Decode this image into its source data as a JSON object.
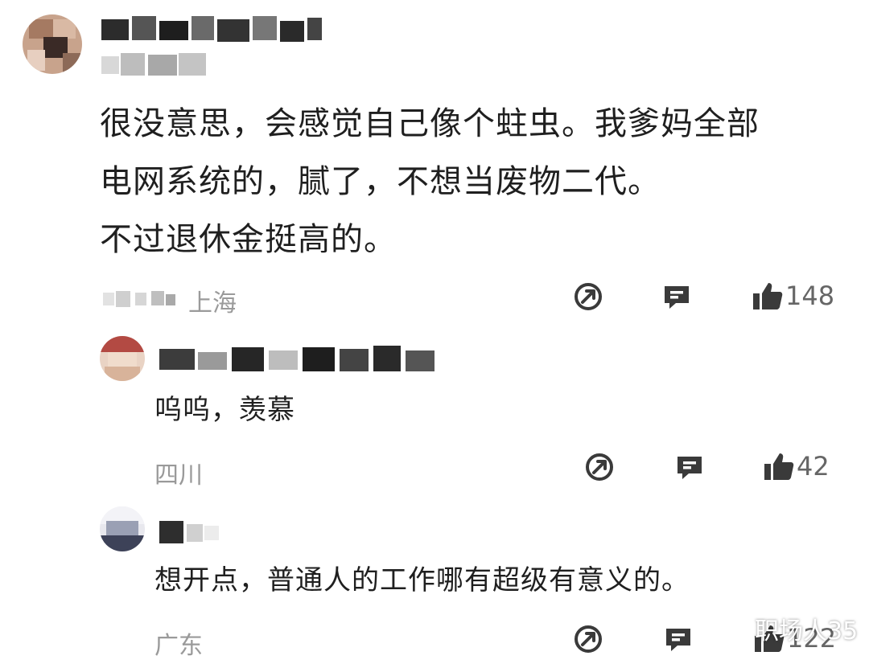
{
  "comments": [
    {
      "id": "main",
      "text_lines": [
        "很没意思，会感觉自己像个蛀虫。我爹妈全部",
        "电网系统的，腻了，不想当废物二代。",
        "不过退休金挺高的。"
      ],
      "location": "上海",
      "likes": "148"
    },
    {
      "id": "reply1",
      "text": "呜呜，羡慕",
      "location": "四川",
      "likes": "42"
    },
    {
      "id": "reply2",
      "text": "想开点，普通人的工作哪有超级有意义的。",
      "location": "广东",
      "likes": "122"
    }
  ],
  "watermark": "职场人35",
  "icons": {
    "share": "share-icon",
    "comment": "comment-icon",
    "like": "thumbs-up-icon"
  },
  "colors": {
    "text": "#1f1f1f",
    "meta": "#9a9a9a",
    "icon": "#3a3a3a",
    "background": "#ffffff"
  }
}
